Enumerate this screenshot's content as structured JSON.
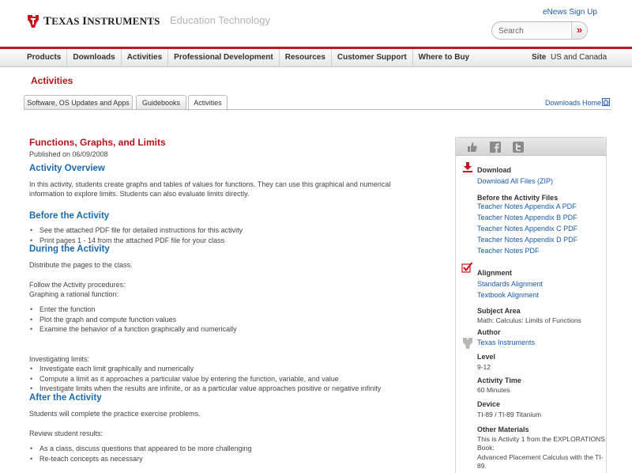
{
  "header": {
    "logo_text_a": "T",
    "logo_text_b": "EXAS ",
    "logo_text_c": "I",
    "logo_text_d": "NSTRUMENTS",
    "division": "Education Technology",
    "enews": "eNews Sign Up",
    "search_placeholder": "Search",
    "search_button": "»"
  },
  "nav": {
    "items": [
      "Products",
      "Downloads",
      "Activities",
      "Professional Development",
      "Resources",
      "Customer Support",
      "Where to Buy"
    ],
    "site_label": "Site",
    "site_value": "US and Canada"
  },
  "section_title": "Activities",
  "tabs": [
    {
      "label": "Software, OS Updates and Apps",
      "active": false
    },
    {
      "label": "Guidebooks",
      "active": false
    },
    {
      "label": "Activities",
      "active": true
    }
  ],
  "downloads_home": "Downloads Home",
  "activity": {
    "title": "Functions, Graphs, and Limits",
    "published": "Published on 06/09/2008",
    "overview_heading": "Activity Overview",
    "overview_line1": "In this activity, students create graphs and tables of values for functions. They can use this graphical and numerical",
    "overview_line2": "information to explore limits. Students can also evaluate limits directly.",
    "before_heading": "Before the Activity",
    "before_items": [
      "See the attached PDF file for detailed instructions for this activity",
      "Print pages 1 - 14 from the attached PDF file for your class"
    ],
    "during_heading": "During the Activity",
    "during_intro": "Distribute the pages to the class.",
    "during_follow": "Follow the Activity procedures:",
    "during_graphing": "Graphing a rational function:",
    "graphing_items": [
      "Enter the function",
      "Plot the graph and compute function values",
      "Examine the behavior of a function graphically and numerically"
    ],
    "investigating_label": "Investigating limits:",
    "investigating_items": [
      "Investigate each limit graphically and numerically",
      "Compute a limit as it approaches a particular value by entering the function, variable, and value",
      "Investigate limits when the results are infinite, or as a particular value approaches positive or negative infinity"
    ],
    "after_heading": "After the Activity",
    "after_intro": "Students will complete the practice exercise problems.",
    "after_review": "Review student results:",
    "after_items": [
      "As a class, discuss questions that appeared to be more challenging",
      "Re-teach concepts as necessary"
    ]
  },
  "sidebar": {
    "download_heading": "Download",
    "download_all": "Download All Files (ZIP)",
    "before_files_heading": "Before the Activity Files",
    "before_files": [
      "Teacher Notes Appendix A PDF",
      "Teacher Notes Appendix B PDF",
      "Teacher Notes Appendix C PDF",
      "Teacher Notes Appendix D PDF",
      "Teacher Notes PDF"
    ],
    "alignment_heading": "Alignment",
    "standards_alignment": "Standards Alignment",
    "textbook_alignment": "Textbook Alignment",
    "subject_heading": "Subject Area",
    "subject_value": "Math: Calculus: Limits of Functions",
    "author_heading": "Author",
    "author_value": "Texas Instruments",
    "level_heading": "Level",
    "level_value": "9-12",
    "time_heading": "Activity Time",
    "time_value": "60 Minutes",
    "device_heading": "Device",
    "device_value": "TI-89 / TI-89 Titanium",
    "other_heading": "Other Materials",
    "other_line1": "This is Activity 1 from the EXPLORATIONS",
    "other_line2": "Book:",
    "other_line3": "Advanced Placement Calculus with the TI-",
    "other_line4": "89."
  },
  "colors": {
    "brand_red": "#c4161c",
    "link_blue": "#1a5aa8",
    "heading_blue": "#1a6aad"
  },
  "icons": [
    "ti-logo-icon",
    "like-icon",
    "facebook-icon",
    "twitter-icon",
    "download-icon",
    "checkbox-icon",
    "ti-author-icon",
    "home-icon"
  ]
}
